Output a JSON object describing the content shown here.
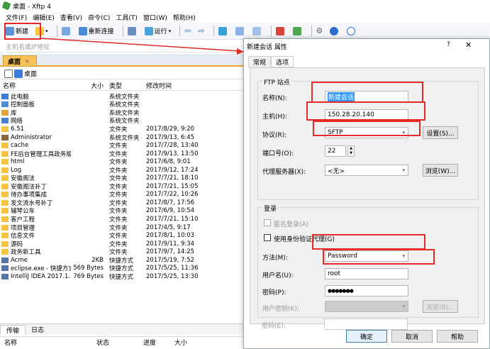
{
  "window": {
    "title": "桌面 - Xftp 4"
  },
  "menu": [
    "文件(F)",
    "编辑(E)",
    "查看(V)",
    "命令(C)",
    "工具(T)",
    "窗口(W)",
    "帮助(H)"
  ],
  "toolbar": {
    "new_label": "新建",
    "reconnect_label": "重新连接",
    "run_label": "运行"
  },
  "address_placeholder": "主机名或IP地址",
  "left_tab": "桌面",
  "path_label": "桌面",
  "columns": {
    "name": "名称",
    "size": "大小",
    "type": "类型",
    "modified": "修改时间"
  },
  "files": [
    {
      "name": "此电脑",
      "size": "",
      "type": "系统文件夹",
      "modified": "",
      "icon": "computer-icon"
    },
    {
      "name": "控制面板",
      "size": "",
      "type": "系统文件夹",
      "modified": "",
      "icon": "control-panel-icon"
    },
    {
      "name": "库",
      "size": "",
      "type": "系统文件夹",
      "modified": "",
      "icon": "library-icon"
    },
    {
      "name": "网络",
      "size": "",
      "type": "系统文件夹",
      "modified": "",
      "icon": "network-icon"
    },
    {
      "name": "6.51",
      "size": "",
      "type": "文件夹",
      "modified": "2017/8/29, 9:20",
      "icon": "folder-icon"
    },
    {
      "name": "Administrator",
      "size": "",
      "type": "系统文件夹",
      "modified": "2017/9/13, 6:45",
      "icon": "user-folder-icon"
    },
    {
      "name": "cache",
      "size": "",
      "type": "文件夹",
      "modified": "2017/7/28, 13:40",
      "icon": "folder-icon"
    },
    {
      "name": "FE后台管理工具政务版",
      "size": "",
      "type": "文件夹",
      "modified": "2017/9/13, 13:50",
      "icon": "folder-icon"
    },
    {
      "name": "html",
      "size": "",
      "type": "文件夹",
      "modified": "2017/6/8, 9:01",
      "icon": "folder-icon"
    },
    {
      "name": "Log",
      "size": "",
      "type": "文件夹",
      "modified": "2017/9/12, 17:24",
      "icon": "folder-icon"
    },
    {
      "name": "安徽阁法",
      "size": "",
      "type": "文件夹",
      "modified": "2017/7/21, 18:10",
      "icon": "folder-icon"
    },
    {
      "name": "安徽阁法补丁",
      "size": "",
      "type": "文件夹",
      "modified": "2017/7/21, 15:05",
      "icon": "folder-icon"
    },
    {
      "name": "待办事项集成",
      "size": "",
      "type": "文件夹",
      "modified": "2017/7/22, 10:26",
      "icon": "folder-icon"
    },
    {
      "name": "发文流水号补丁",
      "size": "",
      "type": "文件夹",
      "modified": "2017/8/7, 17:56",
      "icon": "folder-icon"
    },
    {
      "name": "辅琴公车",
      "size": "",
      "type": "文件夹",
      "modified": "2017/6/9, 10:54",
      "icon": "folder-icon"
    },
    {
      "name": "客户工程",
      "size": "",
      "type": "文件夹",
      "modified": "2017/7/21, 15:10",
      "icon": "folder-icon"
    },
    {
      "name": "项目管理",
      "size": "",
      "type": "文件夹",
      "modified": "2017/4/5, 9:17",
      "icon": "folder-icon"
    },
    {
      "name": "信息文件",
      "size": "",
      "type": "文件夹",
      "modified": "2017/8/1, 10:03",
      "icon": "folder-icon"
    },
    {
      "name": "源码",
      "size": "",
      "type": "文件夹",
      "modified": "2017/9/11, 9:34",
      "icon": "folder-icon"
    },
    {
      "name": "政务新工具",
      "size": "",
      "type": "文件夹",
      "modified": "2017/9/7, 14:25",
      "icon": "folder-icon"
    },
    {
      "name": "Acme",
      "size": "2KB",
      "type": "快捷方式",
      "modified": "2017/5/19, 7:52",
      "icon": "shortcut-icon"
    },
    {
      "name": "eclipse.exe - 快捷方式",
      "size": "569 Bytes",
      "type": "快捷方式",
      "modified": "2017/5/25, 11:36",
      "icon": "shortcut-icon"
    },
    {
      "name": "IntelliJ IDEA 2017.1....",
      "size": "769 Bytes",
      "type": "快捷方式",
      "modified": "2017/5/25, 13:30",
      "icon": "shortcut-icon"
    }
  ],
  "transfer": {
    "tab_transfer": "传输",
    "tab_log": "日志",
    "col_name": "名称",
    "col_status": "状态",
    "col_progress": "进度",
    "col_size": "大小"
  },
  "dialog": {
    "title": "新建会话 属性",
    "help": "?",
    "close": "✕",
    "tab_general": "常规",
    "tab_options": "选项",
    "ftp_group": "FTP 站点",
    "name_label": "名称(N):",
    "name_value": "新建会话",
    "host_label": "主机(H):",
    "host_value": "150.28.20.140",
    "protocol_label": "协议(R):",
    "protocol_value": "SFTP",
    "settings_button": "设置(S)...",
    "port_label": "端口号(O):",
    "port_value": "22",
    "proxy_label": "代理服务器(X):",
    "proxy_value": "<无>",
    "browse_button": "浏览(W)...",
    "login_group": "登录",
    "anon_label": "匿名登录(A)",
    "agent_label": "使用身份验证代理(G)",
    "method_label": "方法(M):",
    "method_value": "Password",
    "user_label": "用户名(U):",
    "user_value": "root",
    "password_label": "密码(P):",
    "password_value": "●●●●●●●",
    "userkey_label": "用户密钥(K):",
    "browse2_button": "浏览(B)...",
    "passphrase_label": "密码(E):",
    "ok": "确定",
    "cancel": "取消",
    "help_button": "帮助"
  },
  "colors": {
    "accent": "#e52a2a",
    "tab_orange": "#f6c35a",
    "folder": "#f5c441"
  }
}
